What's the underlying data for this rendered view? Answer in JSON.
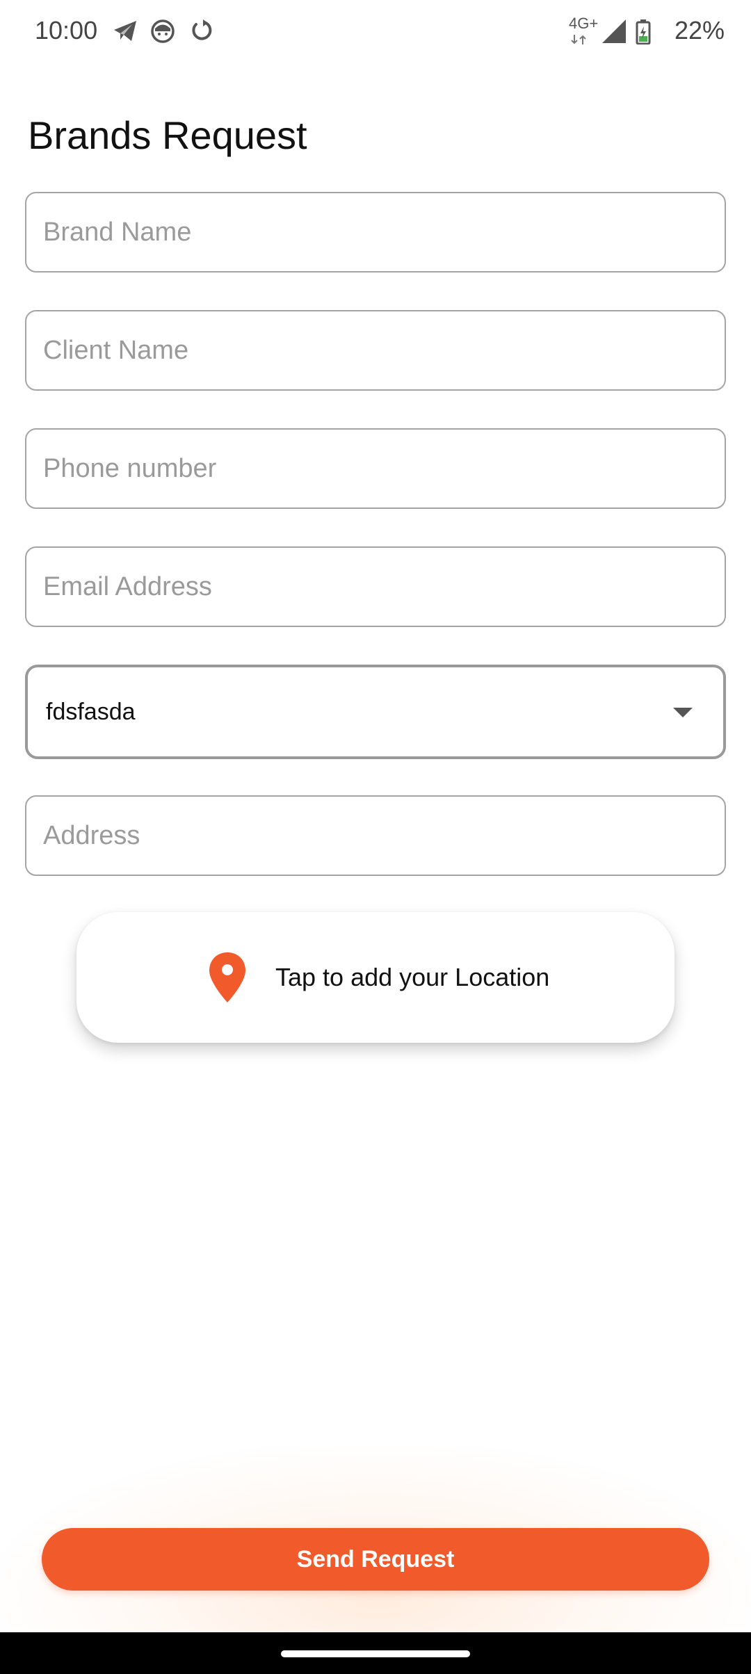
{
  "status_bar": {
    "time": "10:00",
    "network": "4G+",
    "battery": "22%",
    "left_icons": [
      "telegram-icon",
      "face-icon",
      "sync-icon"
    ],
    "right_icons": [
      "network-4g-icon",
      "signal-icon",
      "battery-icon"
    ]
  },
  "page": {
    "title": "Brands Request"
  },
  "form": {
    "brand_name": {
      "placeholder": "Brand Name",
      "value": ""
    },
    "client_name": {
      "placeholder": "Client Name",
      "value": ""
    },
    "phone_number": {
      "placeholder": "Phone number",
      "value": ""
    },
    "email_address": {
      "placeholder": "Email Address",
      "value": ""
    },
    "dropdown": {
      "selected": "fdsfasda",
      "icon": "chevron-down-icon"
    },
    "address": {
      "placeholder": "Address",
      "value": ""
    }
  },
  "location": {
    "label": "Tap to add your Location",
    "icon": "location-pin-icon",
    "icon_color": "#F15A2B"
  },
  "actions": {
    "send_label": "Send Request"
  },
  "colors": {
    "accent": "#F15A2B",
    "border": "#A4A4A4",
    "placeholder": "#9A9A9A"
  }
}
